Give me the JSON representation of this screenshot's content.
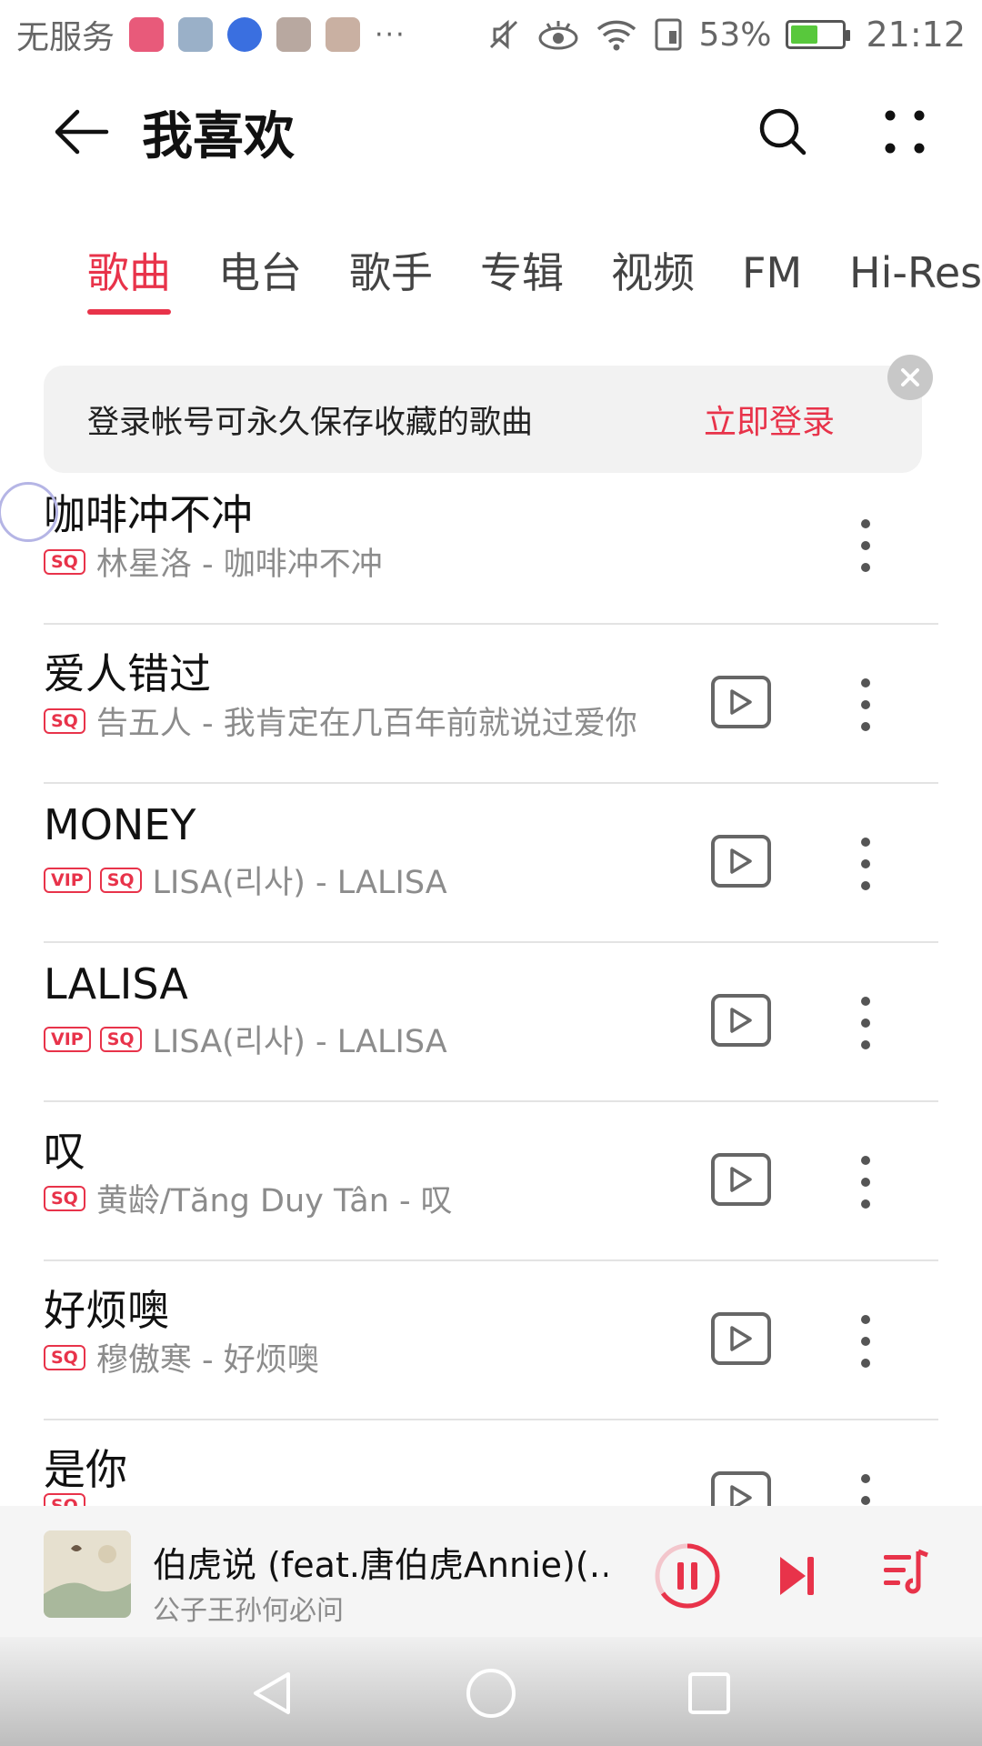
{
  "status_bar": {
    "carrier": "无服务",
    "more": "···",
    "battery": "53%",
    "battery_level": 0.53,
    "time": "21:12"
  },
  "header": {
    "title": "我喜欢"
  },
  "tabs": [
    {
      "label": "歌曲",
      "active": true
    },
    {
      "label": "电台",
      "active": false
    },
    {
      "label": "歌手",
      "active": false
    },
    {
      "label": "专辑",
      "active": false
    },
    {
      "label": "视频",
      "active": false
    },
    {
      "label": "FM",
      "active": false
    },
    {
      "label": "Hi-Res",
      "active": false
    }
  ],
  "banner": {
    "text": "登录帐号可永久保存收藏的歌曲",
    "action": "立即登录"
  },
  "songs": [
    {
      "title": "咖啡冲不冲",
      "tags": [
        "SQ"
      ],
      "subtitle": "林星洛 - 咖啡冲不冲",
      "has_play": false
    },
    {
      "title": "爱人错过",
      "tags": [
        "SQ"
      ],
      "subtitle": "告五人 - 我肯定在几百年前就说过爱你",
      "has_play": true
    },
    {
      "title": "MONEY",
      "tags": [
        "VIP",
        "SQ"
      ],
      "subtitle": "LISA(리사) - LALISA",
      "has_play": true
    },
    {
      "title": "LALISA",
      "tags": [
        "VIP",
        "SQ"
      ],
      "subtitle": "LISA(리사) - LALISA",
      "has_play": true
    },
    {
      "title": "叹",
      "tags": [
        "SQ"
      ],
      "subtitle": "黄龄/Tăng Duy Tân - 叹",
      "has_play": true
    },
    {
      "title": "好烦噢",
      "tags": [
        "SQ"
      ],
      "subtitle": "穆傲寒 - 好烦噢",
      "has_play": true
    },
    {
      "title": "是你",
      "tags": [
        "SQ"
      ],
      "subtitle": "",
      "has_play": true
    }
  ],
  "now_playing": {
    "title": "伯虎说 (feat.唐伯虎Annie)(…",
    "artist": "公子王孙何必问"
  },
  "colors": {
    "accent": "#e8334a",
    "text_primary": "#111111",
    "text_secondary": "#8c8c8c"
  },
  "icons": [
    "back-arrow-icon",
    "search-icon",
    "more-dots-icon",
    "close-icon",
    "play-icon",
    "pause-icon",
    "next-icon",
    "playlist-icon",
    "nav-back-icon",
    "nav-home-icon",
    "nav-recents-icon"
  ]
}
